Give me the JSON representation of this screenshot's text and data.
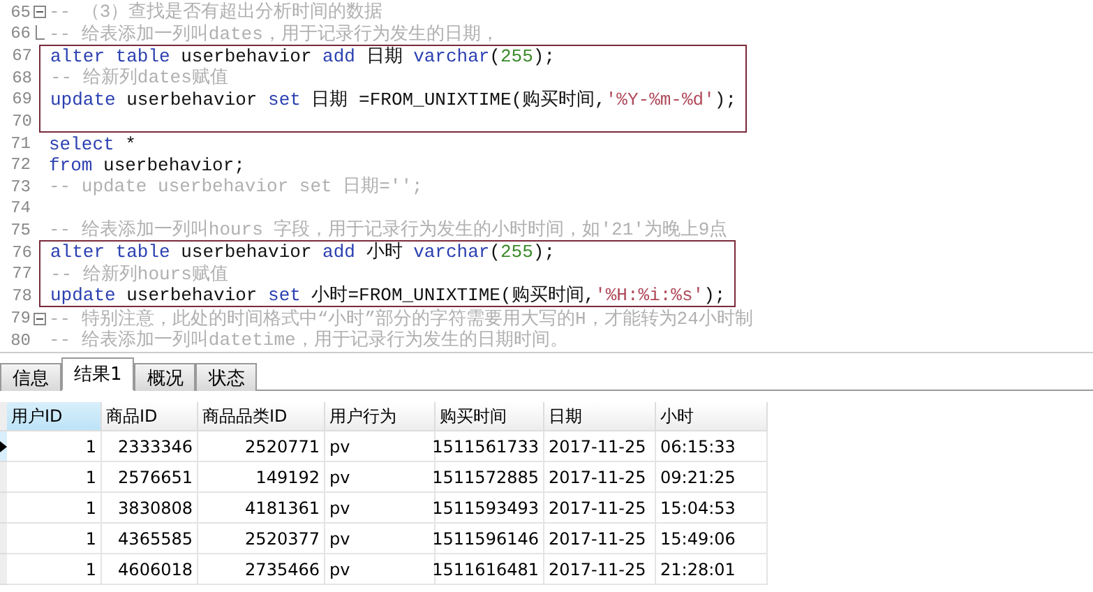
{
  "editor": {
    "blocks": [
      {
        "kind": "line",
        "number": "65",
        "collapsible": true,
        "tokens": [
          {
            "kind": "comment",
            "text": "-- （3）查找是否有超出分析时间的数据"
          }
        ]
      },
      {
        "kind": "line",
        "number": "66",
        "fold_end": true,
        "tokens": [
          {
            "kind": "comment",
            "text": "-- 给表添加一列叫dates，用于记录行为发生的日期，"
          }
        ]
      },
      {
        "kind": "group",
        "lines": [
          {
            "number": "67",
            "tokens": [
              {
                "kind": "keyword",
                "text": "alter table"
              },
              {
                "kind": "plain",
                "text": " userbehavior "
              },
              {
                "kind": "keyword",
                "text": "add"
              },
              {
                "kind": "plain",
                "text": " 日期 "
              },
              {
                "kind": "keyword",
                "text": "varchar"
              },
              {
                "kind": "plain",
                "text": "("
              },
              {
                "kind": "number",
                "text": "255"
              },
              {
                "kind": "plain",
                "text": ");"
              }
            ]
          },
          {
            "number": "68",
            "tokens": [
              {
                "kind": "comment",
                "text": "-- 给新列dates赋值"
              }
            ]
          },
          {
            "number": "69",
            "tokens": [
              {
                "kind": "keyword",
                "text": "update"
              },
              {
                "kind": "plain",
                "text": " userbehavior "
              },
              {
                "kind": "keyword",
                "text": "set"
              },
              {
                "kind": "plain",
                "text": " 日期 =FROM_UNIXTIME(购买时间,"
              },
              {
                "kind": "string",
                "text": "'%Y-%m-%d'"
              },
              {
                "kind": "plain",
                "text": ");"
              }
            ]
          },
          {
            "number": "70"
          }
        ]
      },
      {
        "kind": "line",
        "number": "71",
        "tokens": [
          {
            "kind": "keyword",
            "text": "select"
          },
          {
            "kind": "plain",
            "text": " *"
          }
        ]
      },
      {
        "kind": "line",
        "number": "72",
        "tokens": [
          {
            "kind": "keyword",
            "text": "from"
          },
          {
            "kind": "plain",
            "text": " userbehavior;"
          }
        ]
      },
      {
        "kind": "line",
        "number": "73",
        "tokens": [
          {
            "kind": "comment",
            "text": "-- update userbehavior set 日期='';"
          }
        ]
      },
      {
        "kind": "line",
        "number": "74"
      },
      {
        "kind": "line",
        "number": "75",
        "tokens": [
          {
            "kind": "comment",
            "text": "-- 给表添加一列叫hours 字段，用于记录行为发生的小时时间，如'21'为晚上9点"
          }
        ]
      },
      {
        "kind": "group",
        "lines": [
          {
            "number": "76",
            "tokens": [
              {
                "kind": "keyword",
                "text": "alter table"
              },
              {
                "kind": "plain",
                "text": " userbehavior "
              },
              {
                "kind": "keyword",
                "text": "add"
              },
              {
                "kind": "plain",
                "text": " 小时 "
              },
              {
                "kind": "keyword",
                "text": "varchar"
              },
              {
                "kind": "plain",
                "text": "("
              },
              {
                "kind": "number",
                "text": "255"
              },
              {
                "kind": "plain",
                "text": ");"
              }
            ]
          },
          {
            "number": "77",
            "tokens": [
              {
                "kind": "comment",
                "text": "-- 给新列hours赋值"
              }
            ]
          },
          {
            "number": "78",
            "tokens": [
              {
                "kind": "keyword",
                "text": "update"
              },
              {
                "kind": "plain",
                "text": " userbehavior "
              },
              {
                "kind": "keyword",
                "text": "set"
              },
              {
                "kind": "plain",
                "text": " 小时=FROM_UNIXTIME(购买时间,"
              },
              {
                "kind": "string",
                "text": "'%H:%i:%s'"
              },
              {
                "kind": "plain",
                "text": ");"
              }
            ]
          }
        ]
      },
      {
        "kind": "line",
        "number": "79",
        "collapsible": true,
        "tokens": [
          {
            "kind": "comment",
            "text": "-- 特别注意，此处的时间格式中“小时”部分的字符需要用大写的H，才能转为24小时制"
          }
        ]
      },
      {
        "kind": "line",
        "number": "80",
        "tokens": [
          {
            "kind": "comment",
            "text": "-- 给表添加一列叫datetime，用于记录行为发生的日期时间。"
          }
        ]
      }
    ]
  },
  "tabs": [
    {
      "label": "信息",
      "selected": false
    },
    {
      "label": "结果1",
      "selected": true
    },
    {
      "label": "概况",
      "selected": false
    },
    {
      "label": "状态",
      "selected": false
    }
  ],
  "table": {
    "columns": [
      {
        "label": "用户ID",
        "kind": "number",
        "selected": true
      },
      {
        "label": "商品ID",
        "kind": "number",
        "selected": false
      },
      {
        "label": "商品品类ID",
        "kind": "number",
        "selected": false
      },
      {
        "label": "用户行为",
        "kind": "text",
        "selected": false
      },
      {
        "label": "购买时间",
        "kind": "number",
        "selected": false
      },
      {
        "label": "日期",
        "kind": "text",
        "selected": false
      },
      {
        "label": "小时",
        "kind": "text",
        "selected": false
      }
    ],
    "rows": [
      {
        "current": true,
        "cells": [
          "1",
          "2333346",
          "2520771",
          "pv",
          "1511561733",
          "2017-11-25",
          "06:15:33"
        ]
      },
      {
        "current": false,
        "cells": [
          "1",
          "2576651",
          "149192",
          "pv",
          "1511572885",
          "2017-11-25",
          "09:21:25"
        ]
      },
      {
        "current": false,
        "cells": [
          "1",
          "3830808",
          "4181361",
          "pv",
          "1511593493",
          "2017-11-25",
          "15:04:53"
        ]
      },
      {
        "current": false,
        "cells": [
          "1",
          "4365585",
          "2520377",
          "pv",
          "1511596146",
          "2017-11-25",
          "15:49:06"
        ]
      },
      {
        "current": false,
        "cells": [
          "1",
          "4606018",
          "2735466",
          "pv",
          "1511616481",
          "2017-11-25",
          "21:28:01"
        ]
      }
    ]
  }
}
